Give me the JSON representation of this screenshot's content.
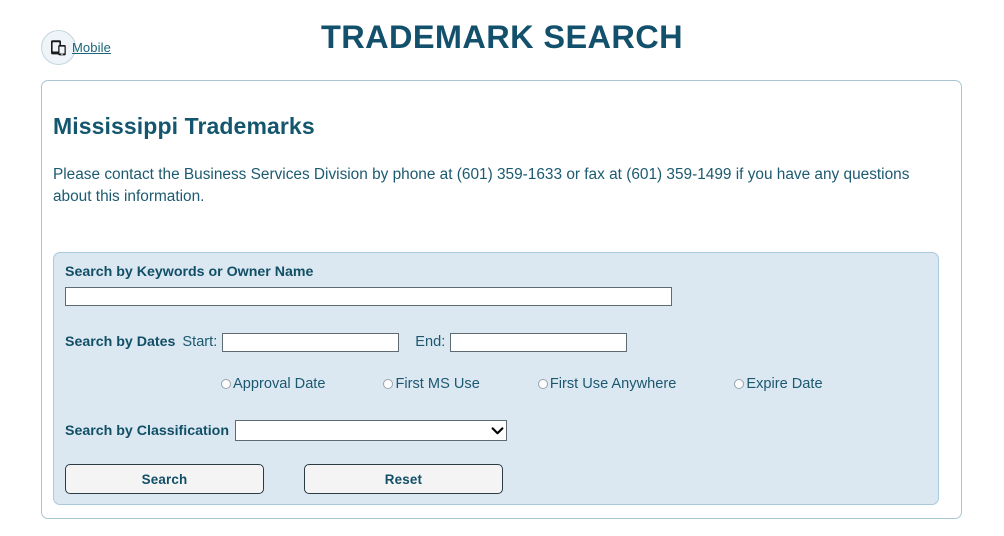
{
  "header": {
    "mobile_link_label": "Mobile",
    "mobile_icon": "mobile-devices-icon",
    "title": "TRADEMARK SEARCH"
  },
  "card": {
    "heading": "Mississippi Trademarks",
    "intro": "Please contact the Business Services Division by phone at (601) 359-1633 or fax at (601) 359-1499 if you have any questions about this information."
  },
  "search_form": {
    "keyword": {
      "label": "Search by Keywords or Owner Name",
      "value": "",
      "placeholder": ""
    },
    "dates": {
      "label": "Search by Dates",
      "start_label": "Start:",
      "start_value": "",
      "start_placeholder": "",
      "end_label": "End:",
      "end_value": "",
      "end_placeholder": ""
    },
    "date_type_options": [
      {
        "label": "Approval Date",
        "selected": false
      },
      {
        "label": "First MS Use",
        "selected": false
      },
      {
        "label": "First Use Anywhere",
        "selected": false
      },
      {
        "label": "Expire Date",
        "selected": false
      }
    ],
    "classification": {
      "label": "Search by Classification",
      "selected_value": "",
      "chevron_icon": "chevron-down-icon"
    },
    "buttons": {
      "search_label": "Search",
      "reset_label": "Reset"
    }
  },
  "colors": {
    "title_teal": "#12506b",
    "heading_teal": "#14566e",
    "panel_blue": "#dce8f1",
    "panel_border": "#a9cadd",
    "card_border": "#a8c6d2",
    "link_teal": "#19657a",
    "button_face": "#f4f4f4",
    "button_border": "#2a3b44"
  }
}
